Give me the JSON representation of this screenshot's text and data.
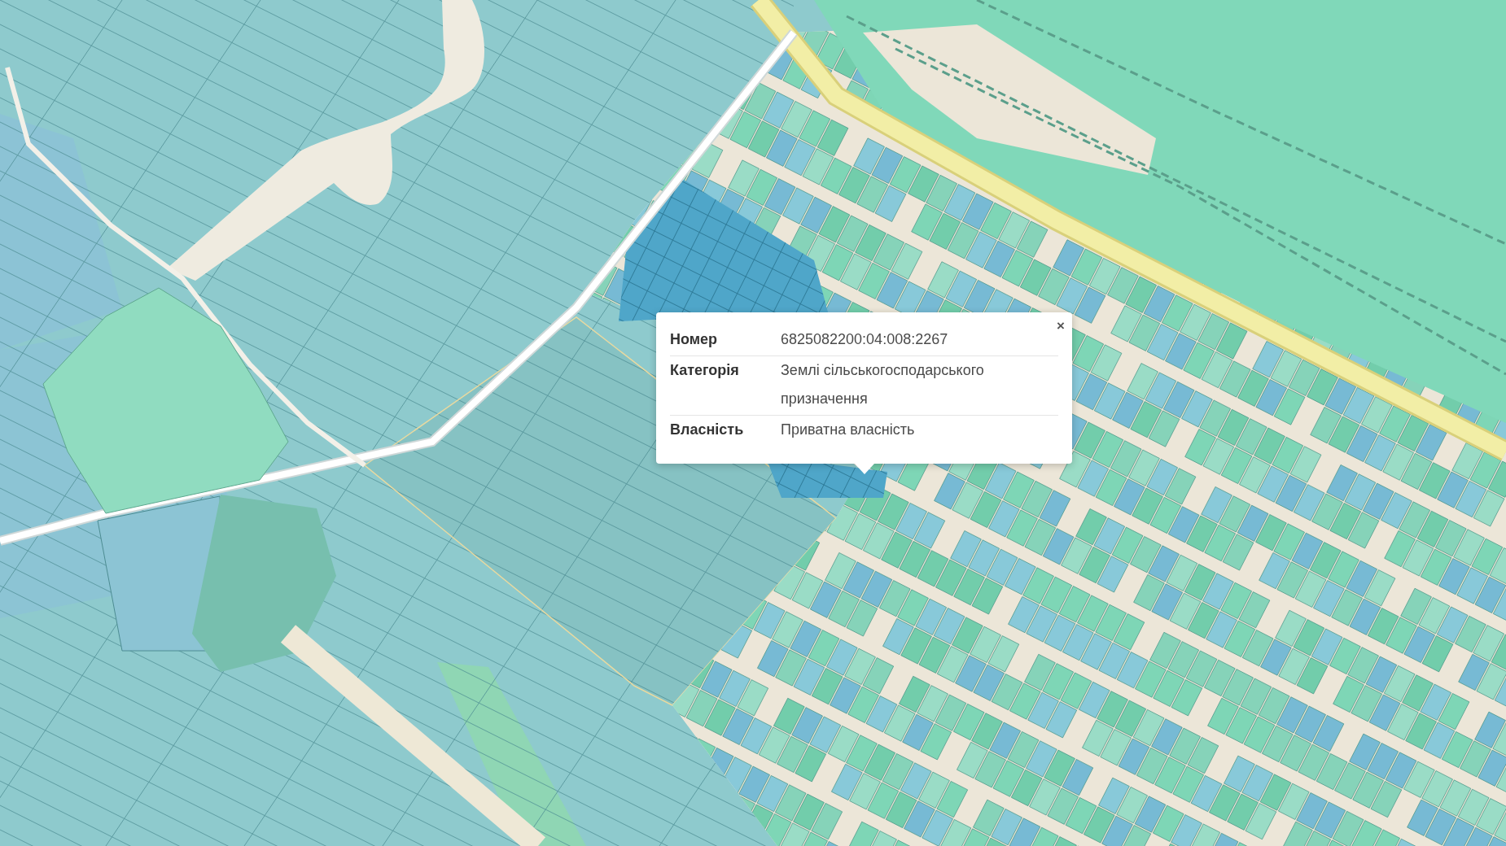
{
  "popup": {
    "close": "×",
    "rows": [
      {
        "label": "Номер",
        "value": "6825082200:04:008:2267"
      },
      {
        "label": "Категорія",
        "value": "Землі сільськогосподарського призначення"
      },
      {
        "label": "Власність",
        "value": "Приватна власність"
      }
    ]
  }
}
